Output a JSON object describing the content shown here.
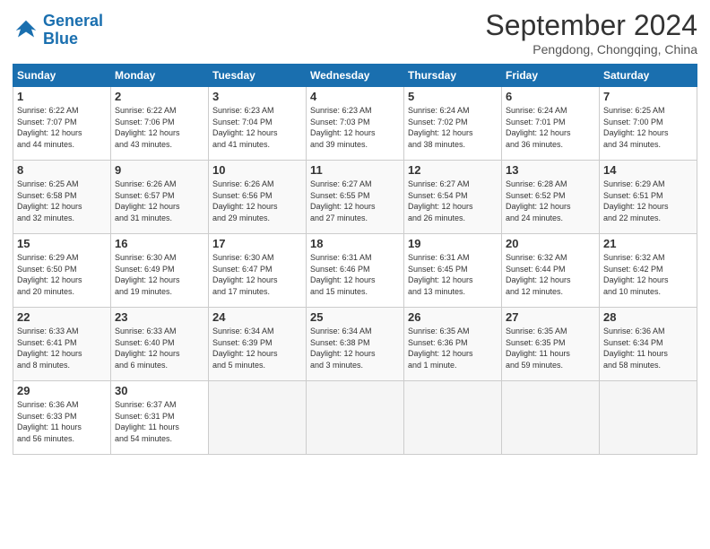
{
  "header": {
    "logo_line1": "General",
    "logo_line2": "Blue",
    "month_title": "September 2024",
    "subtitle": "Pengdong, Chongqing, China"
  },
  "days_of_week": [
    "Sunday",
    "Monday",
    "Tuesday",
    "Wednesday",
    "Thursday",
    "Friday",
    "Saturday"
  ],
  "weeks": [
    [
      {
        "day": "1",
        "info": "Sunrise: 6:22 AM\nSunset: 7:07 PM\nDaylight: 12 hours\nand 44 minutes."
      },
      {
        "day": "2",
        "info": "Sunrise: 6:22 AM\nSunset: 7:06 PM\nDaylight: 12 hours\nand 43 minutes."
      },
      {
        "day": "3",
        "info": "Sunrise: 6:23 AM\nSunset: 7:04 PM\nDaylight: 12 hours\nand 41 minutes."
      },
      {
        "day": "4",
        "info": "Sunrise: 6:23 AM\nSunset: 7:03 PM\nDaylight: 12 hours\nand 39 minutes."
      },
      {
        "day": "5",
        "info": "Sunrise: 6:24 AM\nSunset: 7:02 PM\nDaylight: 12 hours\nand 38 minutes."
      },
      {
        "day": "6",
        "info": "Sunrise: 6:24 AM\nSunset: 7:01 PM\nDaylight: 12 hours\nand 36 minutes."
      },
      {
        "day": "7",
        "info": "Sunrise: 6:25 AM\nSunset: 7:00 PM\nDaylight: 12 hours\nand 34 minutes."
      }
    ],
    [
      {
        "day": "8",
        "info": "Sunrise: 6:25 AM\nSunset: 6:58 PM\nDaylight: 12 hours\nand 32 minutes."
      },
      {
        "day": "9",
        "info": "Sunrise: 6:26 AM\nSunset: 6:57 PM\nDaylight: 12 hours\nand 31 minutes."
      },
      {
        "day": "10",
        "info": "Sunrise: 6:26 AM\nSunset: 6:56 PM\nDaylight: 12 hours\nand 29 minutes."
      },
      {
        "day": "11",
        "info": "Sunrise: 6:27 AM\nSunset: 6:55 PM\nDaylight: 12 hours\nand 27 minutes."
      },
      {
        "day": "12",
        "info": "Sunrise: 6:27 AM\nSunset: 6:54 PM\nDaylight: 12 hours\nand 26 minutes."
      },
      {
        "day": "13",
        "info": "Sunrise: 6:28 AM\nSunset: 6:52 PM\nDaylight: 12 hours\nand 24 minutes."
      },
      {
        "day": "14",
        "info": "Sunrise: 6:29 AM\nSunset: 6:51 PM\nDaylight: 12 hours\nand 22 minutes."
      }
    ],
    [
      {
        "day": "15",
        "info": "Sunrise: 6:29 AM\nSunset: 6:50 PM\nDaylight: 12 hours\nand 20 minutes."
      },
      {
        "day": "16",
        "info": "Sunrise: 6:30 AM\nSunset: 6:49 PM\nDaylight: 12 hours\nand 19 minutes."
      },
      {
        "day": "17",
        "info": "Sunrise: 6:30 AM\nSunset: 6:47 PM\nDaylight: 12 hours\nand 17 minutes."
      },
      {
        "day": "18",
        "info": "Sunrise: 6:31 AM\nSunset: 6:46 PM\nDaylight: 12 hours\nand 15 minutes."
      },
      {
        "day": "19",
        "info": "Sunrise: 6:31 AM\nSunset: 6:45 PM\nDaylight: 12 hours\nand 13 minutes."
      },
      {
        "day": "20",
        "info": "Sunrise: 6:32 AM\nSunset: 6:44 PM\nDaylight: 12 hours\nand 12 minutes."
      },
      {
        "day": "21",
        "info": "Sunrise: 6:32 AM\nSunset: 6:42 PM\nDaylight: 12 hours\nand 10 minutes."
      }
    ],
    [
      {
        "day": "22",
        "info": "Sunrise: 6:33 AM\nSunset: 6:41 PM\nDaylight: 12 hours\nand 8 minutes."
      },
      {
        "day": "23",
        "info": "Sunrise: 6:33 AM\nSunset: 6:40 PM\nDaylight: 12 hours\nand 6 minutes."
      },
      {
        "day": "24",
        "info": "Sunrise: 6:34 AM\nSunset: 6:39 PM\nDaylight: 12 hours\nand 5 minutes."
      },
      {
        "day": "25",
        "info": "Sunrise: 6:34 AM\nSunset: 6:38 PM\nDaylight: 12 hours\nand 3 minutes."
      },
      {
        "day": "26",
        "info": "Sunrise: 6:35 AM\nSunset: 6:36 PM\nDaylight: 12 hours\nand 1 minute."
      },
      {
        "day": "27",
        "info": "Sunrise: 6:35 AM\nSunset: 6:35 PM\nDaylight: 11 hours\nand 59 minutes."
      },
      {
        "day": "28",
        "info": "Sunrise: 6:36 AM\nSunset: 6:34 PM\nDaylight: 11 hours\nand 58 minutes."
      }
    ],
    [
      {
        "day": "29",
        "info": "Sunrise: 6:36 AM\nSunset: 6:33 PM\nDaylight: 11 hours\nand 56 minutes."
      },
      {
        "day": "30",
        "info": "Sunrise: 6:37 AM\nSunset: 6:31 PM\nDaylight: 11 hours\nand 54 minutes."
      },
      {
        "day": "",
        "info": ""
      },
      {
        "day": "",
        "info": ""
      },
      {
        "day": "",
        "info": ""
      },
      {
        "day": "",
        "info": ""
      },
      {
        "day": "",
        "info": ""
      }
    ]
  ]
}
